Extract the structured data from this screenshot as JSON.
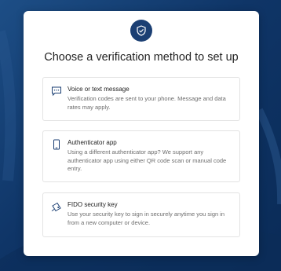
{
  "page": {
    "title": "Choose a verification method to set up"
  },
  "icons": {
    "header": "shield-check-icon",
    "voice": "chat-bubble-icon",
    "authenticator": "smartphone-icon",
    "fido": "security-key-icon"
  },
  "colors": {
    "background": "#0f3567",
    "badge": "#1b3f73",
    "card": "#ffffff",
    "icon": "#1b3f73"
  },
  "options": [
    {
      "title": "Voice or text message",
      "description": "Verification codes are sent to your phone. Message and data rates may apply."
    },
    {
      "title": "Authenticator app",
      "description": "Using a different authenticator app? We support any authenticator app using either QR code scan or manual code entry."
    },
    {
      "title": "FIDO security key",
      "description": "Use your security key to sign in securely anytime you sign in from a new computer or device."
    }
  ]
}
